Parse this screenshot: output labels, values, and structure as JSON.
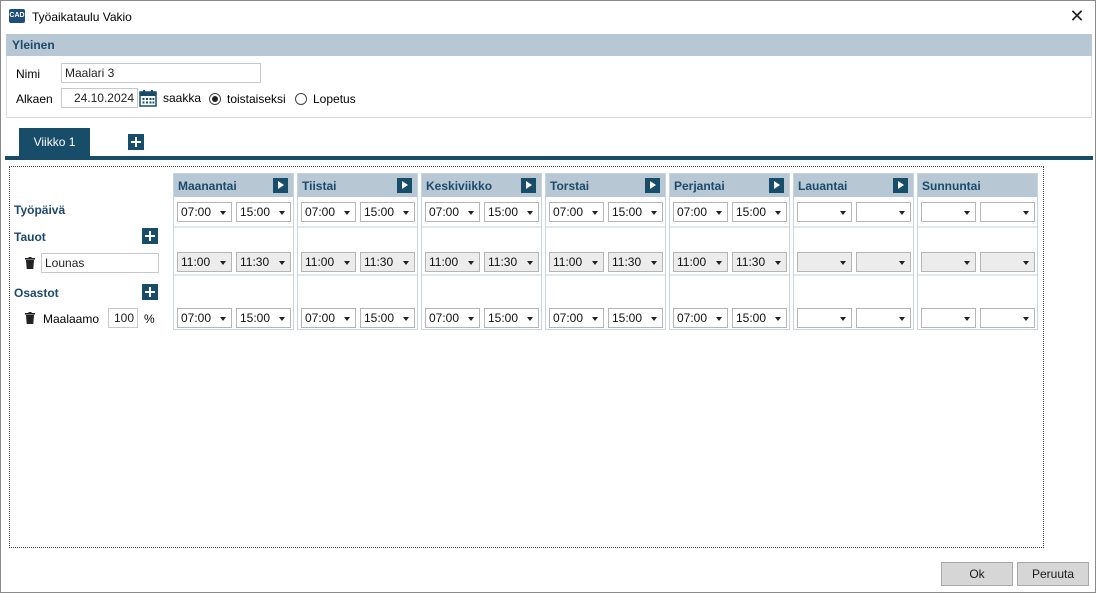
{
  "window": {
    "title": "Työaikataulu Vakio",
    "icon": "app-logo-icon",
    "close": "✕"
  },
  "general": {
    "header": "Yleinen",
    "name_label": "Nimi",
    "name_value": "Maalari 3",
    "start_label": "Alkaen",
    "start_value": "24.10.2024",
    "until_label": "saakka",
    "radio_indefinite": "toistaiseksi",
    "radio_end": "Lopetus"
  },
  "tabs": [
    {
      "label": "Viikko 1",
      "active": true
    }
  ],
  "rows": {
    "workday": "Työpäivä",
    "breaks": "Tauot",
    "break_name": "Lounas",
    "departments": "Osastot",
    "department_name": "Maalaamo",
    "department_percent": "100",
    "percent_sign": "%"
  },
  "days": [
    {
      "name": "Maanantai",
      "work": [
        "07:00",
        "15:00"
      ],
      "break": [
        "11:00",
        "11:30"
      ],
      "dept": [
        "07:00",
        "15:00"
      ]
    },
    {
      "name": "Tiistai",
      "work": [
        "07:00",
        "15:00"
      ],
      "break": [
        "11:00",
        "11:30"
      ],
      "dept": [
        "07:00",
        "15:00"
      ]
    },
    {
      "name": "Keskiviikko",
      "work": [
        "07:00",
        "15:00"
      ],
      "break": [
        "11:00",
        "11:30"
      ],
      "dept": [
        "07:00",
        "15:00"
      ]
    },
    {
      "name": "Torstai",
      "work": [
        "07:00",
        "15:00"
      ],
      "break": [
        "11:00",
        "11:30"
      ],
      "dept": [
        "07:00",
        "15:00"
      ]
    },
    {
      "name": "Perjantai",
      "work": [
        "07:00",
        "15:00"
      ],
      "break": [
        "11:00",
        "11:30"
      ],
      "dept": [
        "07:00",
        "15:00"
      ]
    },
    {
      "name": "Lauantai",
      "work": [
        "",
        ""
      ],
      "break": [
        "",
        ""
      ],
      "dept": [
        "",
        ""
      ]
    },
    {
      "name": "Sunnuntai",
      "work": [
        "",
        ""
      ],
      "break": [
        "",
        ""
      ],
      "dept": [
        "",
        ""
      ]
    }
  ],
  "buttons": {
    "ok": "Ok",
    "cancel": "Peruuta"
  },
  "colors": {
    "accent": "#184d6a",
    "header_bg": "#b7c8d4",
    "header_text": "#1d4a6a"
  }
}
